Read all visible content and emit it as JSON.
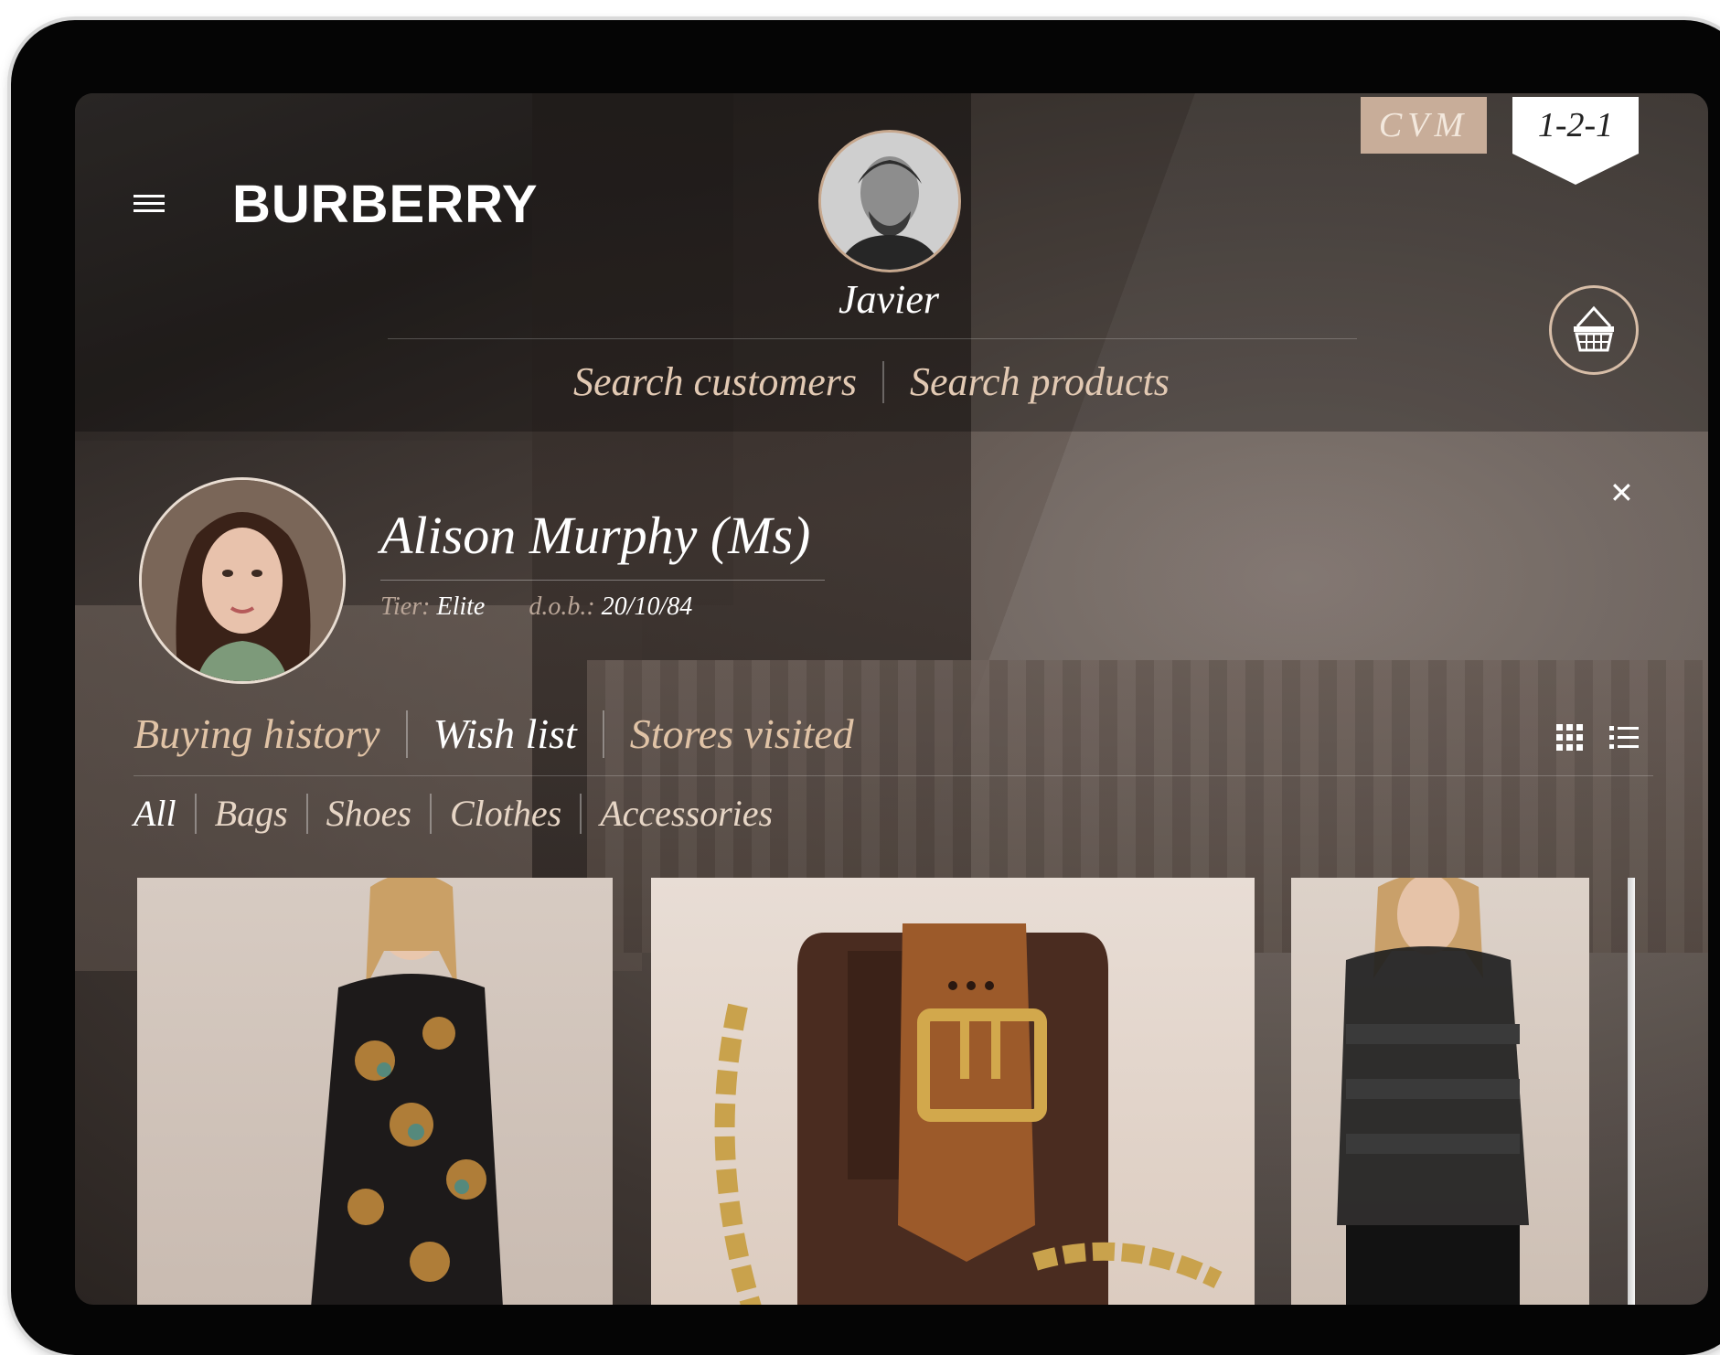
{
  "header": {
    "brand": "BURBERRY",
    "agent_name": "Javier",
    "search_customers": "Search customers",
    "search_products": "Search products",
    "cvm_label": "CVM",
    "one_to_one_label": "1-2-1"
  },
  "customer": {
    "name": "Alison  Murphy (Ms)",
    "tier_label": "Tier:",
    "tier_value": "Elite",
    "dob_label": "d.o.b.:",
    "dob_value": "20/10/84"
  },
  "tabs": [
    {
      "label": "Buying history",
      "active": false
    },
    {
      "label": "Wish list",
      "active": true
    },
    {
      "label": "Stores visited",
      "active": false
    }
  ],
  "filters": [
    {
      "label": "All",
      "active": true
    },
    {
      "label": "Bags",
      "active": false
    },
    {
      "label": "Shoes",
      "active": false
    },
    {
      "label": "Clothes",
      "active": false
    },
    {
      "label": "Accessories",
      "active": false
    }
  ],
  "products": [
    {
      "name": "floral-print-dress"
    },
    {
      "name": "leather-buckle-bag"
    },
    {
      "name": "sheer-striped-shirt"
    }
  ],
  "colors": {
    "accent_tan": "#c8ad99",
    "link_gold": "#e0c3a6",
    "background_dark": "#2a2421"
  },
  "icons": {
    "menu": "hamburger-icon",
    "basket": "basket-icon",
    "close": "close-icon",
    "grid_view": "grid-view-icon",
    "list_view": "list-view-icon"
  }
}
